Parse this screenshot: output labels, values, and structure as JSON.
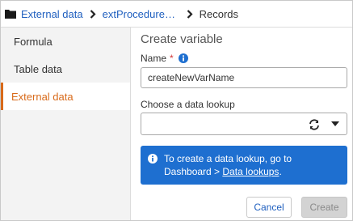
{
  "breadcrumb": {
    "items": [
      "External data",
      "extProceduresLi...",
      "Records"
    ]
  },
  "sidebar": {
    "items": [
      {
        "label": "Formula",
        "active": false
      },
      {
        "label": "Table data",
        "active": false
      },
      {
        "label": "External data",
        "active": true
      }
    ]
  },
  "main": {
    "title": "Create variable",
    "name_label": "Name",
    "required_mark": "*",
    "name_value": "createNewVarName",
    "lookup_label": "Choose a data lookup",
    "lookup_value": "",
    "info": {
      "text_line1": "To create a data lookup, go to",
      "text_prefix": "Dashboard > ",
      "link_text": "Data lookups",
      "text_suffix": "."
    },
    "cancel_label": "Cancel",
    "create_label": "Create"
  },
  "colors": {
    "link": "#1f5fbf",
    "active_accent": "#d86a1a",
    "info_background": "#1e6fd0",
    "required": "#d23a3a"
  },
  "icons": [
    "folder-icon",
    "chevron-right-icon",
    "info-icon",
    "refresh-icon",
    "caret-down-icon"
  ]
}
